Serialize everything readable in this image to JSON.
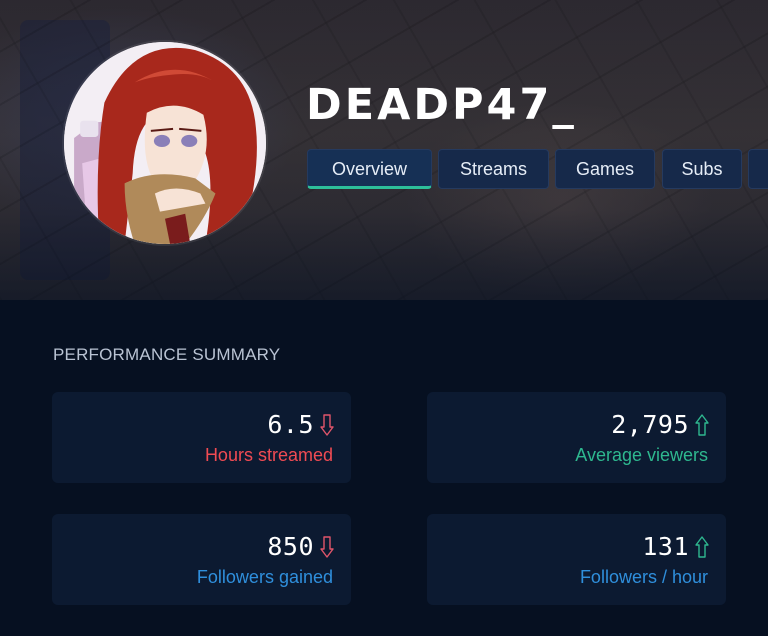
{
  "channel": {
    "name": "DEADP47_"
  },
  "tabs": [
    {
      "label": "Overview",
      "active": true
    },
    {
      "label": "Streams"
    },
    {
      "label": "Games"
    },
    {
      "label": "Subs"
    },
    {
      "label": ""
    }
  ],
  "summary": {
    "title": "PERFORMANCE SUMMARY",
    "cards": [
      {
        "value": "6.5",
        "label": "Hours streamed",
        "trend": "down",
        "label_color": "#f04b53"
      },
      {
        "value": "2,795",
        "label": "Average viewers",
        "trend": "up",
        "label_color": "#2eb88f"
      },
      {
        "value": "850",
        "label": "Followers gained",
        "trend": "down",
        "label_color": "#2f8fdc"
      },
      {
        "value": "131",
        "label": "Followers / hour",
        "trend": "up",
        "label_color": "#2f8fdc"
      }
    ]
  },
  "colors": {
    "background": "#061021",
    "card": "#0c1a31",
    "tab": "#16294a",
    "tab_active_underline": "#2dbf9a",
    "trend_down": "#e0556a",
    "trend_up": "#2eb88f"
  },
  "icons": {
    "trend_down": "arrow-down-icon",
    "trend_up": "arrow-up-icon"
  }
}
